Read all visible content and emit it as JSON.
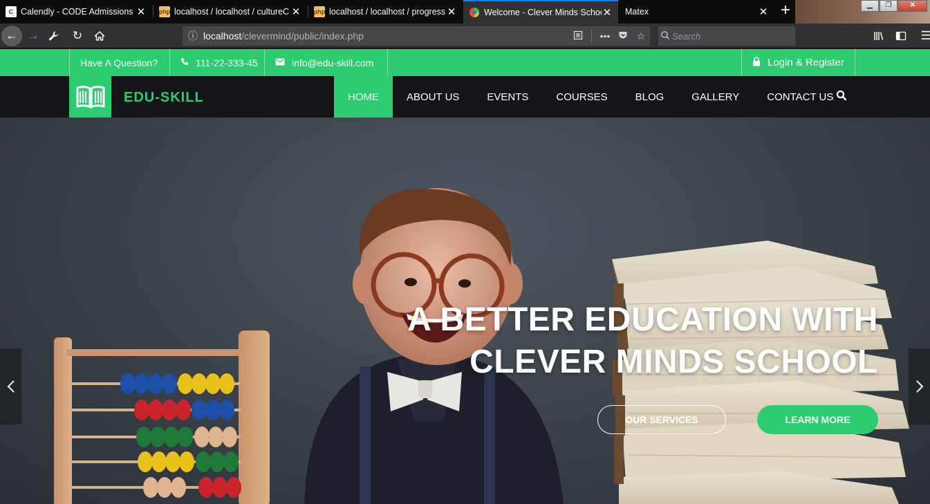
{
  "browser": {
    "tabs": [
      {
        "title": "Calendly - CODE Admissions",
        "favicon": "C"
      },
      {
        "title": "localhost / localhost / cultureC",
        "favicon": "php"
      },
      {
        "title": "localhost / localhost / progress",
        "favicon": "php"
      },
      {
        "title": "Welcome - Clever Minds School",
        "favicon": "chrome-like"
      },
      {
        "title": "Matex",
        "favicon": ""
      }
    ],
    "close_glyph": "✕",
    "new_tab_glyph": "+",
    "url_host": "localhost",
    "url_path": "/clevermind/public/index.php",
    "search_placeholder": "Search"
  },
  "site": {
    "topbar": {
      "question": "Have A Question?",
      "phone": "111-22-333-45",
      "email": "info@edu-skill.com",
      "login": "Login & Register"
    },
    "brand": "EDU-SKILL",
    "nav": [
      "HOME",
      "ABOUT US",
      "EVENTS",
      "COURSES",
      "BLOG",
      "GALLERY",
      "CONTACT US"
    ],
    "hero": {
      "title_line1": "A BETTER EDUCATION WITH",
      "title_line2": "CLEVER MINDS SCHOOL",
      "btn_services": "OUR SERVICES",
      "btn_learn": "LEARN MORE"
    },
    "colors": {
      "accent": "#2ecc71",
      "nav_bg": "#15161a"
    }
  }
}
